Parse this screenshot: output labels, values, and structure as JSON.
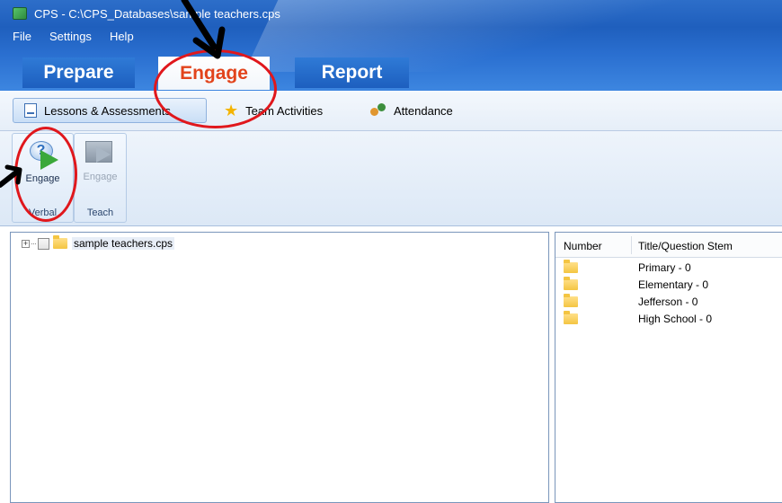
{
  "window": {
    "title": "CPS - C:\\CPS_Databases\\sample teachers.cps"
  },
  "menu": {
    "items": [
      "File",
      "Settings",
      "Help"
    ]
  },
  "main_tabs": [
    {
      "label": "Prepare",
      "selected": false
    },
    {
      "label": "Engage",
      "selected": true
    },
    {
      "label": "Report",
      "selected": false
    }
  ],
  "sub_tabs": [
    {
      "label": "Lessons & Assessments",
      "icon": "document-icon",
      "selected": true
    },
    {
      "label": "Team Activities",
      "icon": "star-icon",
      "selected": false
    },
    {
      "label": "Attendance",
      "icon": "people-icon",
      "selected": false
    }
  ],
  "ribbon": {
    "groups": [
      {
        "label": "Verbal",
        "button": {
          "label": "Engage",
          "icon": "engage-verbal-icon",
          "enabled": true
        }
      },
      {
        "label": "Teach",
        "button": {
          "label": "Engage",
          "icon": "engage-teach-icon",
          "enabled": false
        }
      }
    ]
  },
  "tree": {
    "root": {
      "label": "sample teachers.cps",
      "expander": "+",
      "checked": false
    }
  },
  "list": {
    "columns": [
      "Number",
      "Title/Question Stem"
    ],
    "rows": [
      {
        "number_icon": "folder-icon",
        "title": "Primary  -  0"
      },
      {
        "number_icon": "folder-icon",
        "title": "Elementary  -  0"
      },
      {
        "number_icon": "folder-icon",
        "title": "Jefferson  -  0"
      },
      {
        "number_icon": "folder-icon",
        "title": "High School  -  0"
      }
    ]
  },
  "annotations": {
    "color": "#e0171c",
    "arrow_color": "#000000"
  },
  "colors": {
    "chrome_blue": "#1f5fbd",
    "engage_orange": "#e2431b"
  }
}
